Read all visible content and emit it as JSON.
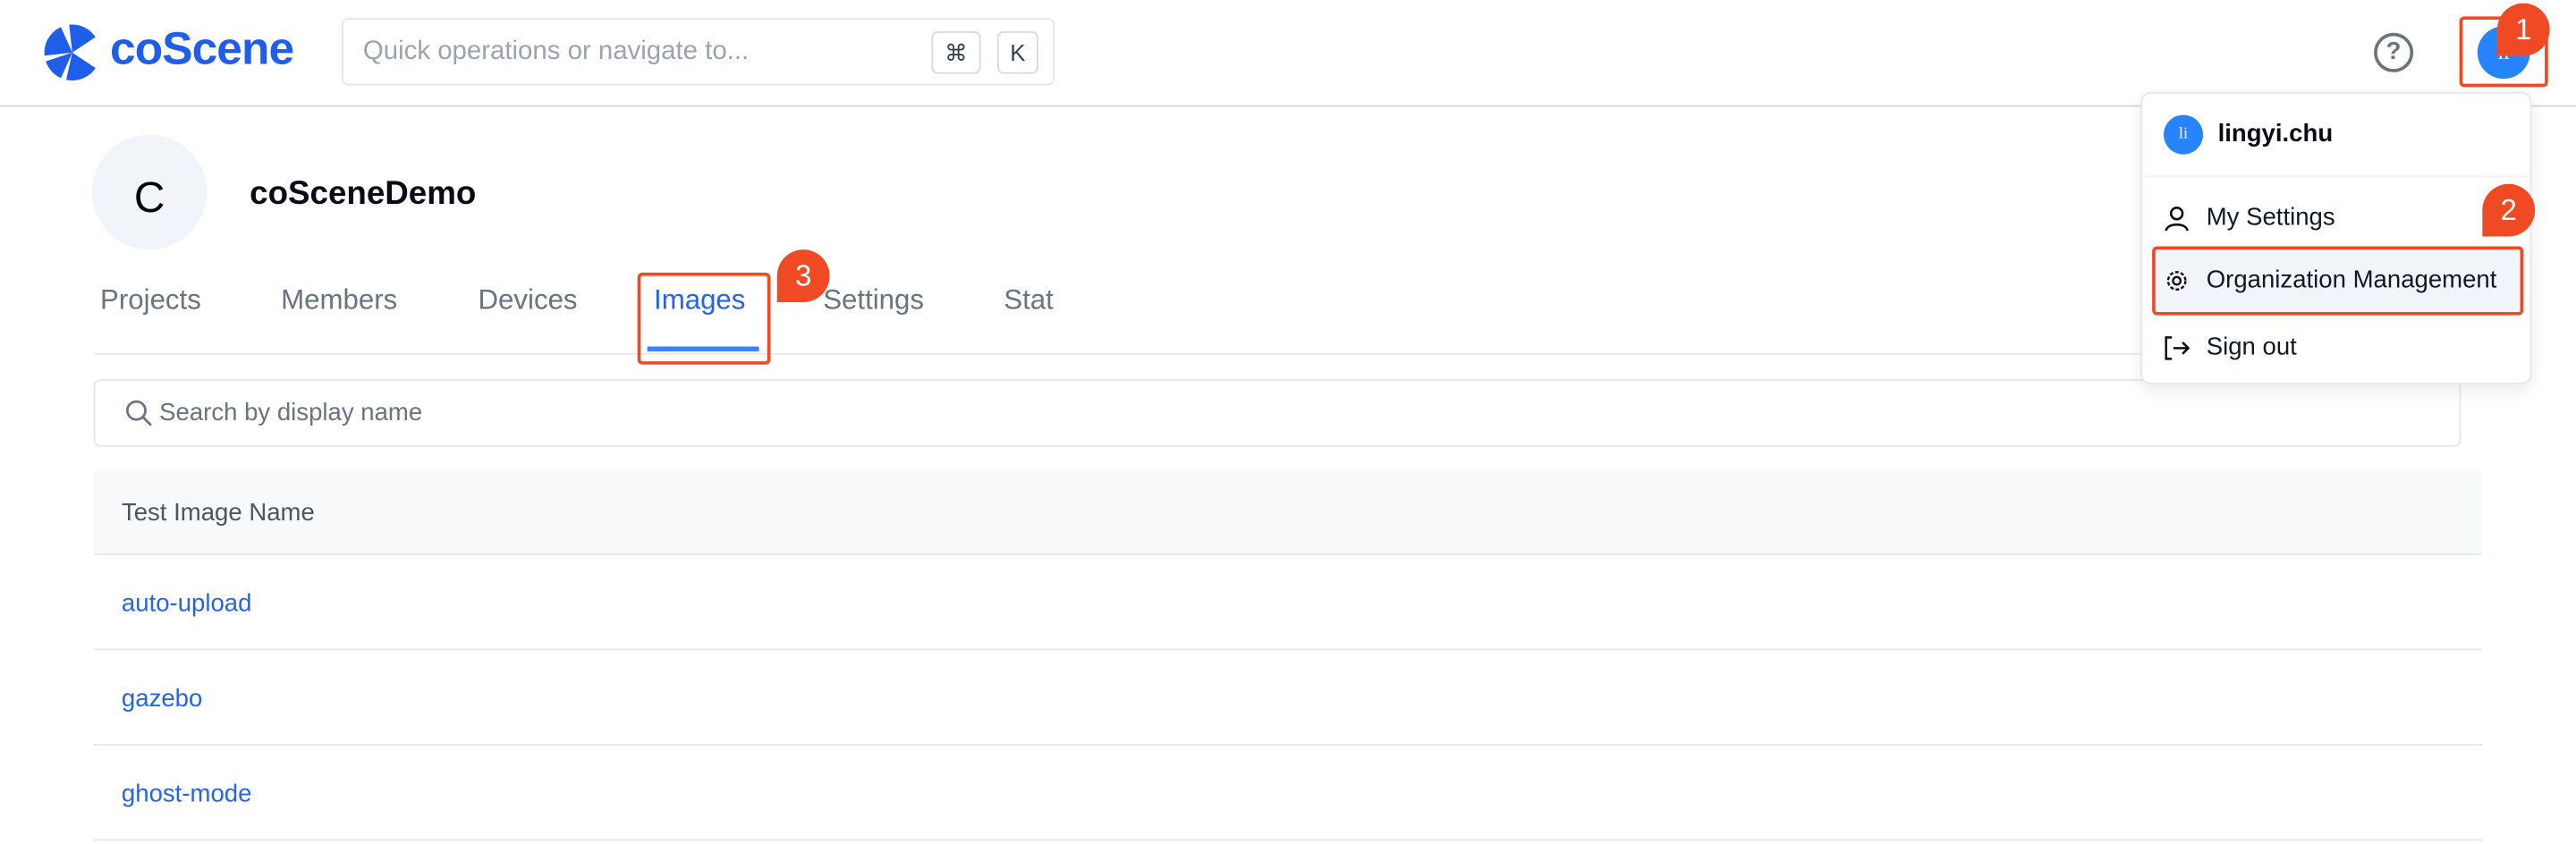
{
  "header": {
    "logo_text": "coScene",
    "quick_search_placeholder": "Quick operations or navigate to...",
    "shortcut_keys": [
      "⌘",
      "K"
    ],
    "help_icon": "question-circle-icon",
    "avatar_initials": "li"
  },
  "org": {
    "avatar_letter": "C",
    "name": "coSceneDemo"
  },
  "tabs": [
    {
      "label": "Projects",
      "active": false
    },
    {
      "label": "Members",
      "active": false
    },
    {
      "label": "Devices",
      "active": false
    },
    {
      "label": "Images",
      "active": true
    },
    {
      "label": "Settings",
      "active": false
    },
    {
      "label": "Stat",
      "active": false
    }
  ],
  "search": {
    "placeholder": "Search by display name"
  },
  "table": {
    "header": "Test Image Name",
    "rows": [
      "auto-upload",
      "gazebo",
      "ghost-mode"
    ]
  },
  "user_menu": {
    "avatar_initials": "li",
    "username": "lingyi.chu",
    "items": [
      {
        "label": "My Settings",
        "icon": "user-icon"
      },
      {
        "label": "Organization Management",
        "icon": "gear-icon",
        "highlighted": true
      },
      {
        "label": "Sign out",
        "icon": "sign-out-icon"
      }
    ]
  },
  "annotations": {
    "step1": "1",
    "step2": "2",
    "step3": "3",
    "color": "#f04a24"
  },
  "colors": {
    "brand": "#1f5eea",
    "accent": "#2563eb",
    "avatar": "#2684ff"
  }
}
